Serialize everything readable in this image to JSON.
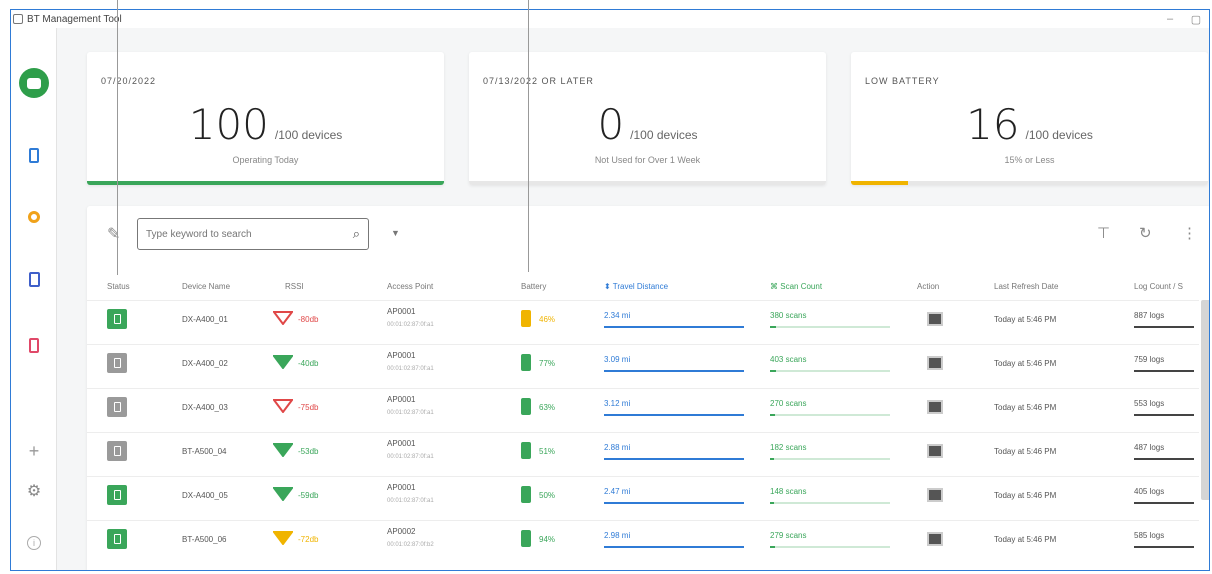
{
  "window": {
    "title": "BT Management Tool",
    "minimize": "–",
    "maximize": "▢"
  },
  "sidebar": {
    "icons": [
      "logo-icon",
      "device-icon",
      "circle-icon",
      "tablet-icon",
      "mobile-icon",
      "plus-icon",
      "gear-icon",
      "info-icon"
    ]
  },
  "cards": [
    {
      "title": "07/20/2022",
      "value": "100",
      "of": "/100 devices",
      "subtitle": "Operating Today",
      "bar_color": "#3aa65a",
      "fill": 1.0
    },
    {
      "title": "07/13/2022 OR LATER",
      "value": "0",
      "of": "/100 devices",
      "subtitle": "Not Used for Over 1 Week",
      "bar_color": "#c8ccd4",
      "fill": 0.0
    },
    {
      "title": "LOW BATTERY",
      "value": "16",
      "of": "/100 devices",
      "subtitle": "15% or Less",
      "bar_color": "#f0b400",
      "fill": 0.16
    }
  ],
  "search": {
    "placeholder": "Type keyword to search"
  },
  "table": {
    "headers": {
      "status": "Status",
      "device_name": "Device Name",
      "rssi": "RSSI",
      "access_point": "Access Point",
      "battery": "Battery",
      "travel_distance": "Travel Distance",
      "scan_count": "Scan Count",
      "action": "Action",
      "last_refresh": "Last Refresh Date",
      "log_count": "Log Count / S"
    },
    "rows": [
      {
        "status_color": "#3aa65a",
        "device": "DX-A400_01",
        "rssi": "-80db",
        "rssi_color": "#e04848",
        "ap": "AP0001",
        "mac": "00:01:02:87:0f:a1",
        "battery": "46%",
        "battery_color": "#f0b400",
        "distance": "2.34 mi",
        "scans": "380 scans",
        "scan_fill": 0.05,
        "refresh": "Today at 5:46 PM",
        "logs": "887 logs"
      },
      {
        "status_color": "#9a9a9a",
        "device": "DX-A400_02",
        "rssi": "-40db",
        "rssi_color": "#3aa65a",
        "ap": "AP0001",
        "mac": "00:01:02:87:0f:a1",
        "battery": "77%",
        "battery_color": "#3aa65a",
        "distance": "3.09 mi",
        "scans": "403 scans",
        "scan_fill": 0.05,
        "refresh": "Today at 5:46 PM",
        "logs": "759 logs"
      },
      {
        "status_color": "#9a9a9a",
        "device": "DX-A400_03",
        "rssi": "-75db",
        "rssi_color": "#e04848",
        "ap": "AP0001",
        "mac": "00:01:02:87:0f:a1",
        "battery": "63%",
        "battery_color": "#3aa65a",
        "distance": "3.12 mi",
        "scans": "270 scans",
        "scan_fill": 0.04,
        "refresh": "Today at 5:46 PM",
        "logs": "553 logs"
      },
      {
        "status_color": "#9a9a9a",
        "device": "BT-A500_04",
        "rssi": "-53db",
        "rssi_color": "#3aa65a",
        "ap": "AP0001",
        "mac": "00:01:02:87:0f:a1",
        "battery": "51%",
        "battery_color": "#3aa65a",
        "distance": "2.88 mi",
        "scans": "182 scans",
        "scan_fill": 0.03,
        "refresh": "Today at 5:46 PM",
        "logs": "487 logs"
      },
      {
        "status_color": "#3aa65a",
        "device": "DX-A400_05",
        "rssi": "-59db",
        "rssi_color": "#3aa65a",
        "ap": "AP0001",
        "mac": "00:01:02:87:0f:a1",
        "battery": "50%",
        "battery_color": "#3aa65a",
        "distance": "2.47 mi",
        "scans": "148 scans",
        "scan_fill": 0.03,
        "refresh": "Today at 5:46 PM",
        "logs": "405 logs"
      },
      {
        "status_color": "#3aa65a",
        "device": "BT-A500_06",
        "rssi": "-72db",
        "rssi_color": "#f0b400",
        "ap": "AP0002",
        "mac": "00:01:02:87:0f:b2",
        "battery": "94%",
        "battery_color": "#3aa65a",
        "distance": "2.98 mi",
        "scans": "279 scans",
        "scan_fill": 0.04,
        "refresh": "Today at 5:46 PM",
        "logs": "585 logs"
      }
    ]
  }
}
